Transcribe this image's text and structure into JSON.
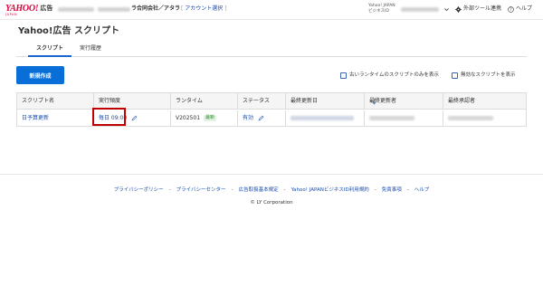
{
  "header": {
    "logo_text": "YAHOO!",
    "logo_sub": "JAPAN",
    "logo_product": "広告",
    "company": "ラ合同会社／アタラ",
    "account_select": "アカウント選択",
    "yid_label_line1": "Yahoo! JAPAN",
    "yid_label_line2": "ビジネスID",
    "external_tools": "外部ツール連携",
    "help": "ヘルプ"
  },
  "page": {
    "title": "Yahoo!広告 スクリプト",
    "tabs": [
      {
        "label": "スクリプト",
        "active": true
      },
      {
        "label": "実行履歴",
        "active": false
      }
    ]
  },
  "toolbar": {
    "new_button": "新規作成",
    "filter_old_runtime": "古いランタイムのスクリプトのみを表示",
    "filter_invalid": "無効なスクリプトを表示"
  },
  "table": {
    "columns": [
      "スクリプト名",
      "実行頻度",
      "ランタイム",
      "ステータス",
      "最終更新日",
      "最終更新者",
      "最終承認者"
    ],
    "rows": [
      {
        "name": "日予算更新",
        "frequency": "毎日 09:00",
        "runtime": "V202501",
        "runtime_badge": "最新",
        "status": "有効"
      }
    ]
  },
  "footer": {
    "links": [
      "プライバシーポリシー",
      "プライバシーセンター",
      "広告取扱基本規定",
      "Yahoo! JAPANビジネスID利用規約",
      "免責事項",
      "ヘルプ"
    ],
    "separator": "-",
    "copyright": "© LY Corporation"
  },
  "colors": {
    "primary": "#0a6ed8",
    "link": "#1a4db3",
    "logo_red": "#e0003a",
    "highlight_border": "#c00000",
    "badge_green": "#2f8a2f"
  }
}
